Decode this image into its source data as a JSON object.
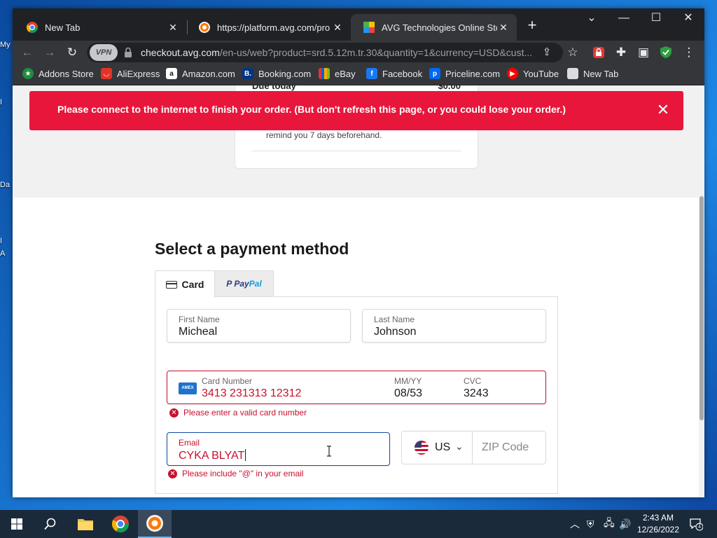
{
  "desktop": {
    "icon_labels": [
      "My",
      "I",
      "Da",
      "I",
      "A"
    ]
  },
  "browser": {
    "tabs": [
      {
        "title": "New Tab",
        "icon": "chrome-icon"
      },
      {
        "title": "https://platform.avg.com/pro",
        "icon": "avg-secure-icon"
      },
      {
        "title": "AVG Technologies Online Store -",
        "icon": "avg-store-icon",
        "active": true
      }
    ],
    "address": {
      "host": "checkout.avg.com",
      "path": "/en-us/web?product=srd.5.12m.tr.30&quantity=1&currency=USD&cust..."
    },
    "vpn_label": "VPN",
    "bookmarks": [
      {
        "label": "Addons Store",
        "icon": "addons-store-icon",
        "color": "#1e8e3e"
      },
      {
        "label": "AliExpress",
        "icon": "aliexpress-icon",
        "color": "#e43225"
      },
      {
        "label": "Amazon.com",
        "icon": "amazon-icon",
        "color": "#ffffff"
      },
      {
        "label": "Booking.com",
        "icon": "booking-icon",
        "color": "#003580"
      },
      {
        "label": "eBay",
        "icon": "ebay-icon",
        "color": "#e53238"
      },
      {
        "label": "Facebook",
        "icon": "facebook-icon",
        "color": "#1877f2"
      },
      {
        "label": "Priceline.com",
        "icon": "priceline-icon",
        "color": "#0068ef"
      },
      {
        "label": "YouTube",
        "icon": "youtube-icon",
        "color": "#ff0000"
      },
      {
        "label": "New Tab",
        "icon": "new-tab-page-icon",
        "color": "#dadce0"
      }
    ]
  },
  "page": {
    "summary": {
      "due_label": "Due today",
      "due_amount": "$0.00",
      "reminder": "remind you 7 days beforehand."
    },
    "alert": {
      "message": "Please connect to the internet to finish your order. (But don't refresh this page, or you could lose your order.)",
      "color": "#e8163b"
    },
    "payment": {
      "title": "Select a payment method",
      "tab_card": "Card",
      "tab_paypal_1": "Pay",
      "tab_paypal_2": "Pal",
      "first_name": {
        "label": "First Name",
        "value": "Micheal"
      },
      "last_name": {
        "label": "Last Name",
        "value": "Johnson"
      },
      "card": {
        "label": "Card Number",
        "value": "3413 231313 12312",
        "brand": "AMEX",
        "expiry_label": "MM/YY",
        "expiry_value": "08/53",
        "cvc_label": "CVC",
        "cvc_value": "3243",
        "error": "Please enter a valid card number"
      },
      "email": {
        "label": "Email",
        "value": "CYKA BLYAT",
        "error": "Please include \"@\" in your email"
      },
      "country": {
        "code": "US"
      },
      "zip": {
        "placeholder": "ZIP Code"
      }
    }
  },
  "taskbar": {
    "time": "2:43 AM",
    "date": "12/26/2022",
    "notification_count": "1"
  }
}
